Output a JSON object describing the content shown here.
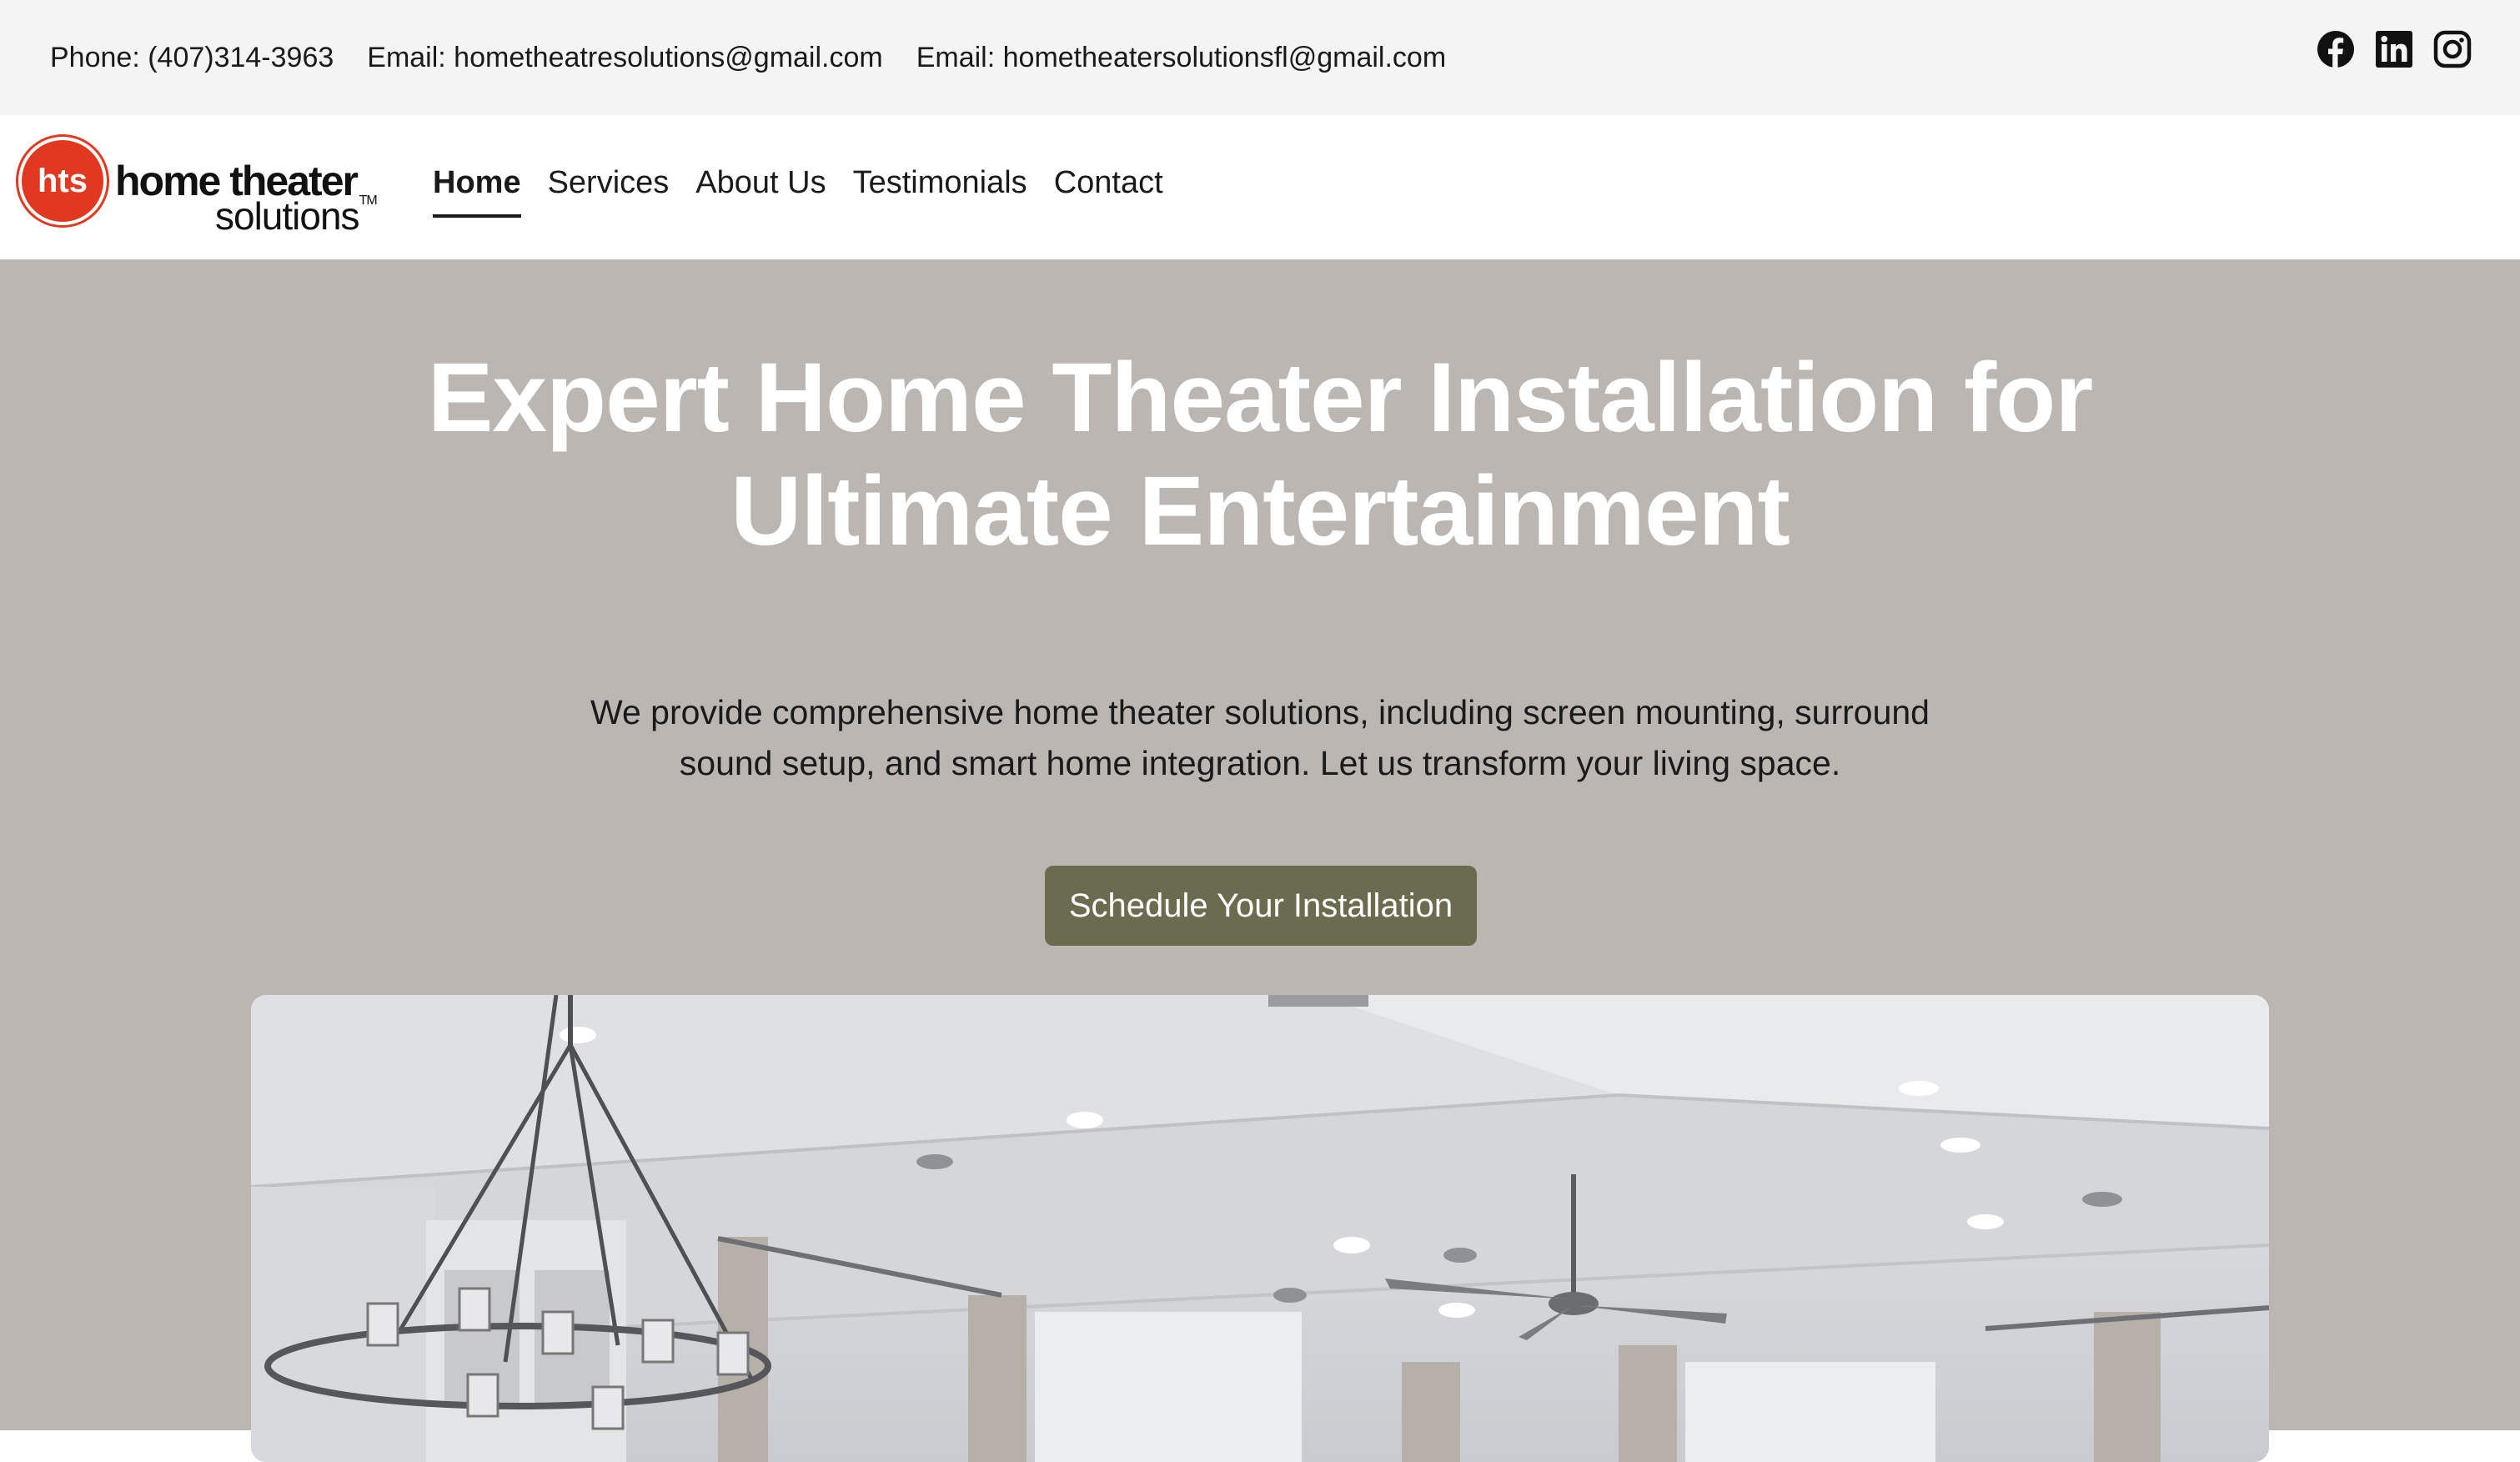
{
  "topbar": {
    "contacts": [
      "Phone: (407)314-3963",
      "Email: hometheatresolutions@gmail.com",
      "Email: hometheatersolutionsfl@gmail.com"
    ],
    "socials": [
      "facebook-icon",
      "linkedin-icon",
      "instagram-icon"
    ]
  },
  "logo": {
    "monogram": "hts",
    "line1": "home theater",
    "line2": "solutions",
    "trademark": "TM"
  },
  "nav": {
    "items": [
      {
        "label": "Home",
        "active": true
      },
      {
        "label": "Services",
        "active": false
      },
      {
        "label": "About Us",
        "active": false
      },
      {
        "label": "Testimonials",
        "active": false
      },
      {
        "label": "Contact",
        "active": false
      }
    ]
  },
  "hero": {
    "title": "Expert Home Theater Installation for Ultimate Entertainment",
    "description": "We provide comprehensive home theater solutions, including screen mounting, surround sound setup, and smart home integration. Let us transform your living space.",
    "cta_label": "Schedule Your Installation",
    "image_alt": "Living room with chandelier and ceiling fan"
  },
  "colors": {
    "topbar_bg": "#f4f4f4",
    "hero_bg": "#bbb6b2",
    "cta_bg": "#6b6b50",
    "brand_red": "#e2381f"
  }
}
